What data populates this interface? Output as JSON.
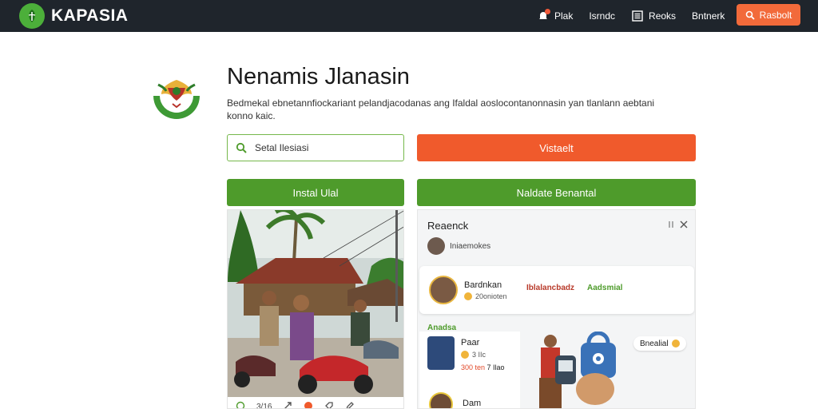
{
  "brand": {
    "name": "KAPASIA"
  },
  "nav": {
    "items": [
      {
        "label": "Plak",
        "icon": "bell-icon"
      },
      {
        "label": "Isrndc",
        "icon": ""
      },
      {
        "label": "Reoks",
        "icon": "list-icon"
      },
      {
        "label": "Bntnerk",
        "icon": ""
      }
    ],
    "cta_label": "Rasbolt"
  },
  "hero": {
    "title": "Nenamis Jlanasin",
    "description": "Bedmekal ebnetannfiockariant pelandjacodanas ang Ifaldal aoslocontanonnasin yan tlanlann aebtani konno kaic."
  },
  "search": {
    "placeholder": "Setal Ilesiasi",
    "button_label": "Vistaelt"
  },
  "tabs": {
    "left": "Instal Ulal",
    "right": "Naldate Benantal"
  },
  "photo_card": {
    "actions": [
      "3/16",
      "",
      "",
      ""
    ]
  },
  "panel": {
    "title": "Reaenck",
    "mini_user": "Iniaemokes",
    "post": {
      "name": "Bardnkan",
      "sub": "20onioten",
      "tag1": "Iblalancbadz",
      "tag2": "Aadsmial"
    },
    "section_label": "Anadsa",
    "person1": {
      "name": "Paar",
      "meta": "3 IIc",
      "price_red": "300 ten",
      "price_rest": "7 Ilao"
    },
    "person2": {
      "name": "Dam"
    },
    "promo_badge": "Bnealial"
  },
  "colors": {
    "topbar": "#1f252c",
    "accent_orange": "#f05a2c",
    "accent_green": "#4e9b2b"
  }
}
